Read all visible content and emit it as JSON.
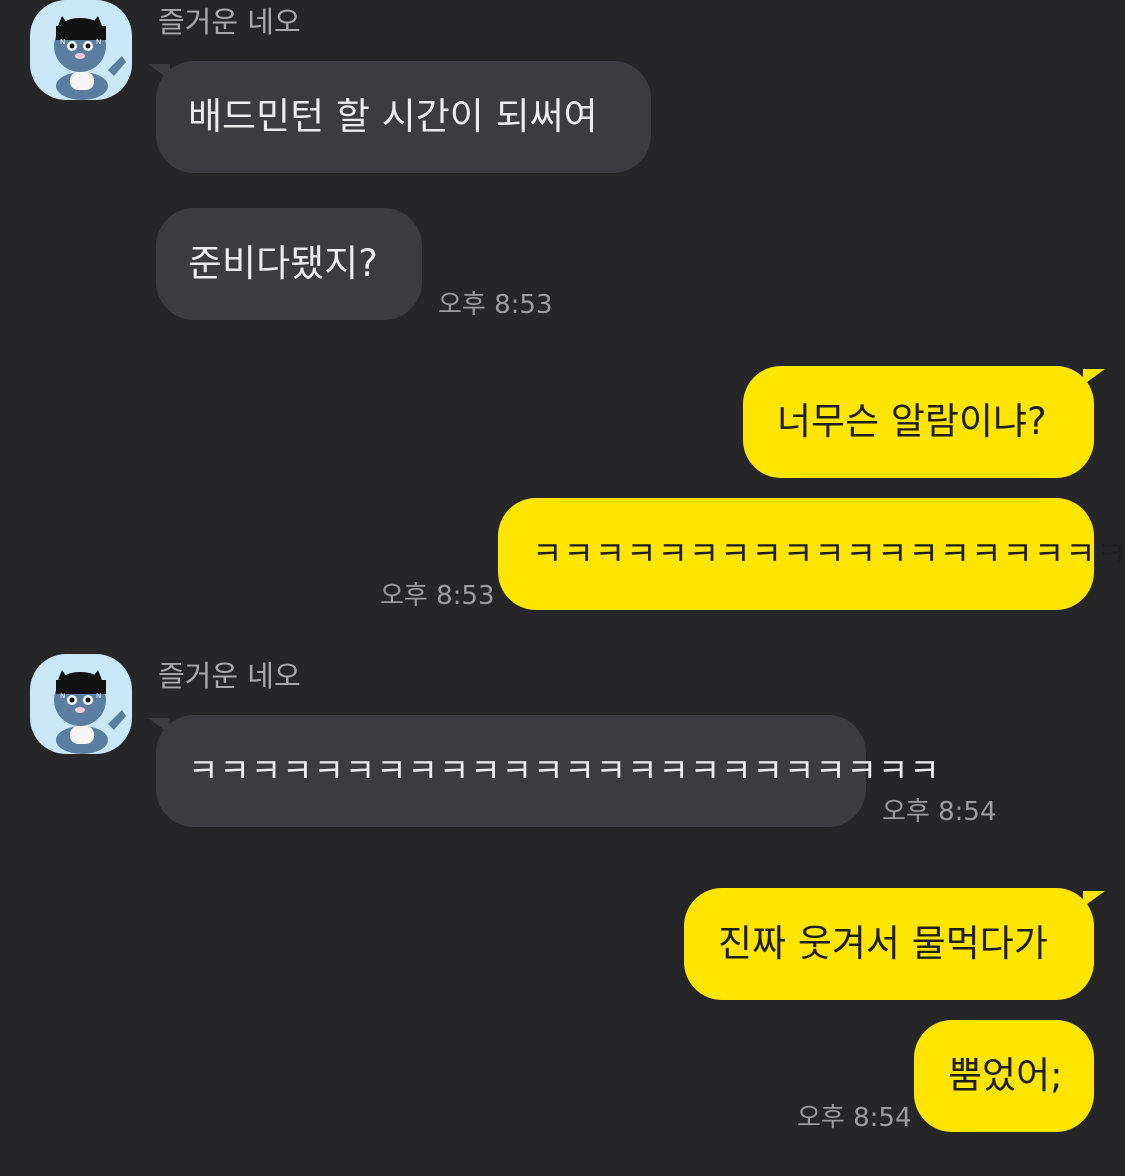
{
  "colors": {
    "background": "#262629",
    "incoming_bubble": "#3c3c40",
    "outgoing_bubble": "#fee500",
    "avatar_bg": "#c9e7f6"
  },
  "avatar_icon": "neo-cat-avatar-icon",
  "messages": {
    "group1": {
      "sender": "즐거운 네오",
      "m1": "배드민턴 할 시간이 되써여",
      "m2": "준비다됐지?",
      "time": "오후 8:53"
    },
    "group2": {
      "m1": "너무슨 알람이냐?",
      "m2": "ㅋㅋㅋㅋㅋㅋㅋㅋㅋㅋㅋㅋㅋㅋㅋㅋㅋㅋㅋㅋ",
      "time": "오후 8:53"
    },
    "group3": {
      "sender": "즐거운 네오",
      "m1": "ㅋㅋㅋㅋㅋㅋㅋㅋㅋㅋㅋㅋㅋㅋㅋㅋㅋㅋㅋㅋㅋㅋㅋㅋ",
      "time": "오후 8:54"
    },
    "group4": {
      "m1": "진짜 웃겨서 물먹다가",
      "m2": "뿜었어;",
      "time": "오후 8:54"
    }
  }
}
